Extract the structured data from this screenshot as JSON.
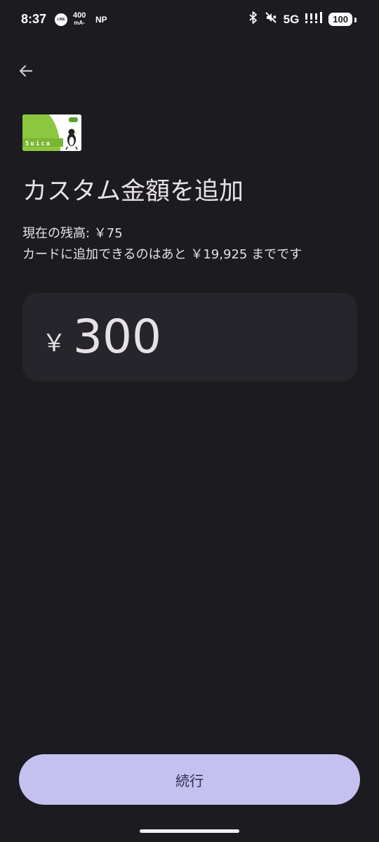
{
  "status_bar": {
    "time": "8:37",
    "line_icon": "LINE",
    "data_rate_value": "400",
    "data_rate_unit": "mA-",
    "np": "NP",
    "network": "5G",
    "battery": "100",
    "icons": [
      "bluetooth-icon",
      "mute-icon",
      "signal-icon"
    ]
  },
  "header": {
    "back_icon": "arrow-left-icon"
  },
  "card": {
    "brand": "Suica",
    "colors": {
      "green": "#8dc63f",
      "white": "#ffffff"
    }
  },
  "main": {
    "title": "カスタム金額を追加",
    "balance_text": "現在の残高: ￥75",
    "limit_text": "カードに追加できるのはあと ￥19,925 までです",
    "currency_symbol": "￥",
    "amount_value": "300"
  },
  "footer": {
    "continue_label": "続行"
  },
  "colors": {
    "background": "#1c1b20",
    "surface": "#26252b",
    "accent": "#c4c1ee",
    "on_accent": "#2d2b4e"
  }
}
